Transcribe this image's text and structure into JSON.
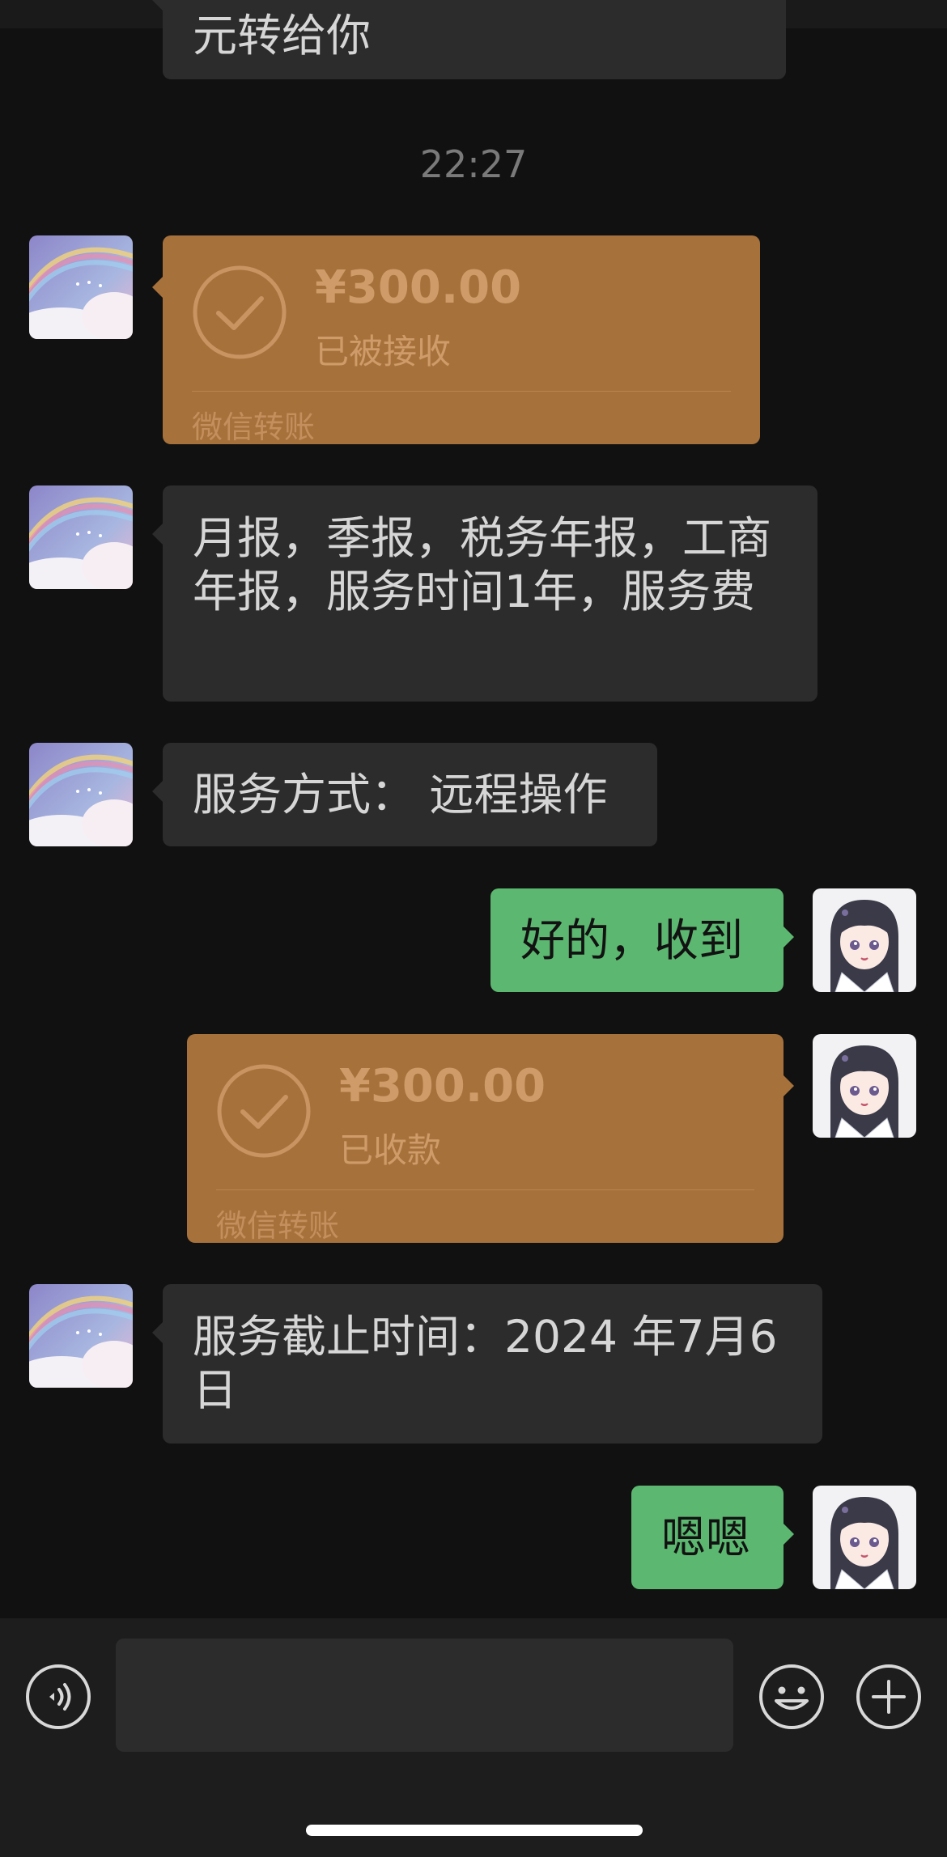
{
  "chat": {
    "partial_message": "元转给你",
    "timestamp": "22:27",
    "transfer_received": {
      "amount": "¥300.00",
      "status": "已被接收",
      "brand": "微信转账"
    },
    "msg_service_scope": "月报，季报，税务年报，工商年报，服务时间1年，服务费",
    "msg_service_mode": "服务方式： 远程操作",
    "reply_ok": "好的，收到",
    "transfer_sent": {
      "amount": "¥300.00",
      "status": "已收款",
      "brand": "微信转账"
    },
    "msg_deadline": "服务截止时间：2024 年7月6日",
    "reply_ack": "嗯嗯"
  },
  "input_bar": {
    "voice_icon": "voice-icon",
    "emoji_icon": "emoji-icon",
    "plus_icon": "plus-icon",
    "message_value": ""
  },
  "colors": {
    "background": "#111111",
    "incoming_bubble": "#2c2c2c",
    "outgoing_bubble": "#5cb870",
    "transfer_card": "#a6713a"
  }
}
